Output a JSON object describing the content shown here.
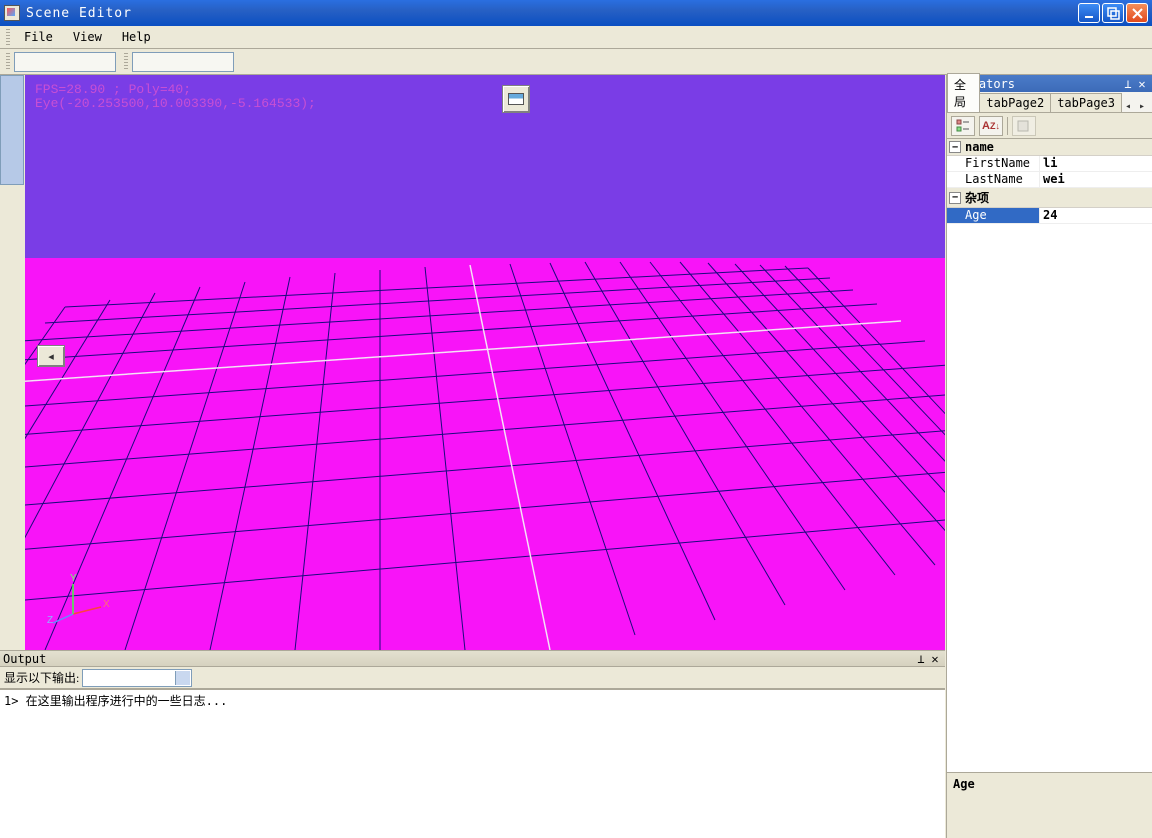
{
  "window": {
    "title": "Scene Editor"
  },
  "menu": {
    "file": "File",
    "view": "View",
    "help": "Help"
  },
  "viewport": {
    "hud_line1": "FPS=28.90 ; Poly=40;",
    "hud_line2": "Eye(-20.253500,10.003390,-5.164533);",
    "axis_x": "X",
    "axis_y": "Y",
    "axis_z": "Z"
  },
  "output": {
    "panel_title": "Output",
    "show_label": "显示以下输出:",
    "log_line": "1> 在这里输出程序进行中的一些日志..."
  },
  "operators": {
    "panel_title": "Operators",
    "tabs": {
      "t1": "全局",
      "t2": "tabPage2",
      "t3": "tabPage3"
    },
    "cat1": "name",
    "row1k": "FirstName",
    "row1v": "li",
    "row2k": "LastName",
    "row2v": "wei",
    "cat2": "杂项",
    "row3k": "Age",
    "row3v": "24",
    "desc_name": "Age"
  },
  "colors": {
    "sky": "#7a3de6",
    "ground": "#f814f8",
    "gridline": "#1a0a7d",
    "gridlight": "#f7e0f7"
  }
}
